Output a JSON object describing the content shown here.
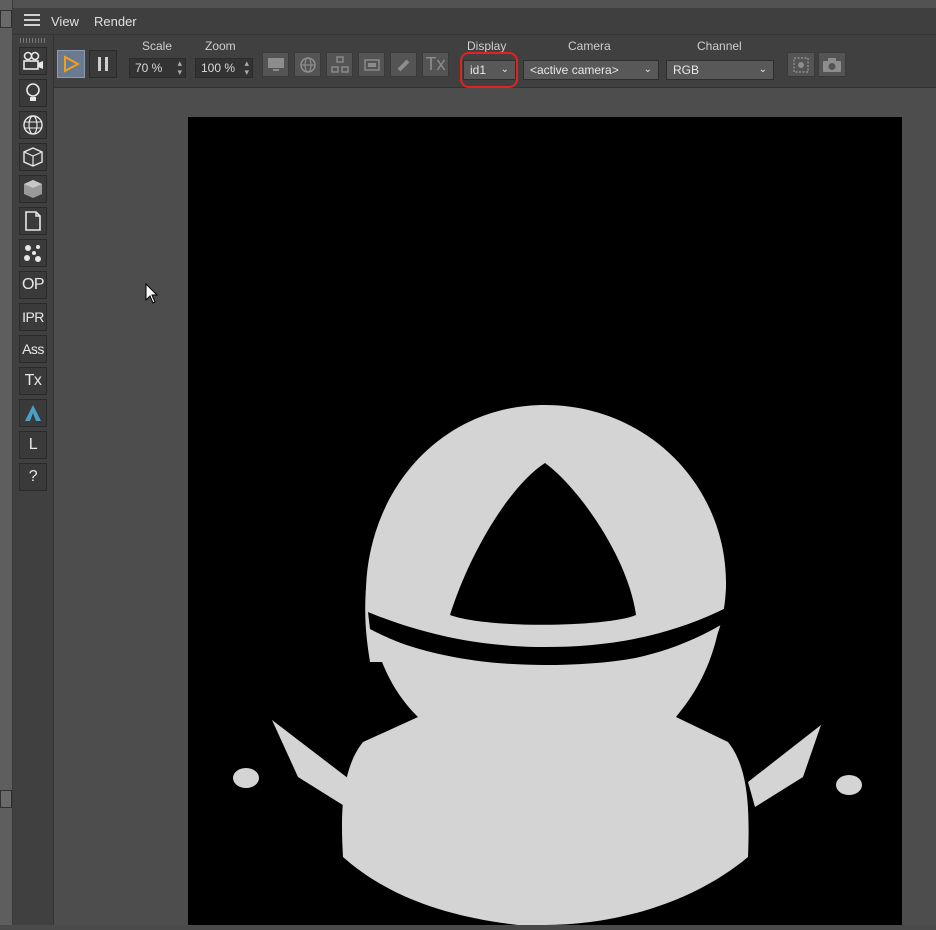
{
  "menubar": {
    "items": [
      "View",
      "Render"
    ]
  },
  "toolbar": {
    "scale": {
      "label": "Scale",
      "value": "70 %"
    },
    "zoom": {
      "label": "Zoom",
      "value": "100 %"
    },
    "display": {
      "label": "Display",
      "value": "id1"
    },
    "camera": {
      "label": "Camera",
      "value": "<active camera>"
    },
    "channel": {
      "label": "Channel",
      "value": "RGB"
    },
    "tx_label": "Tx"
  },
  "side_tools": {
    "op": "OP",
    "ipr": "IPR",
    "ass": "Ass",
    "tx": "Tx",
    "l": "L",
    "help": "?"
  },
  "colors": {
    "highlight": "#e0231f",
    "render_bg": "#000000",
    "render_shape": "#d4d4d4",
    "play_icon": "#f0a020"
  }
}
